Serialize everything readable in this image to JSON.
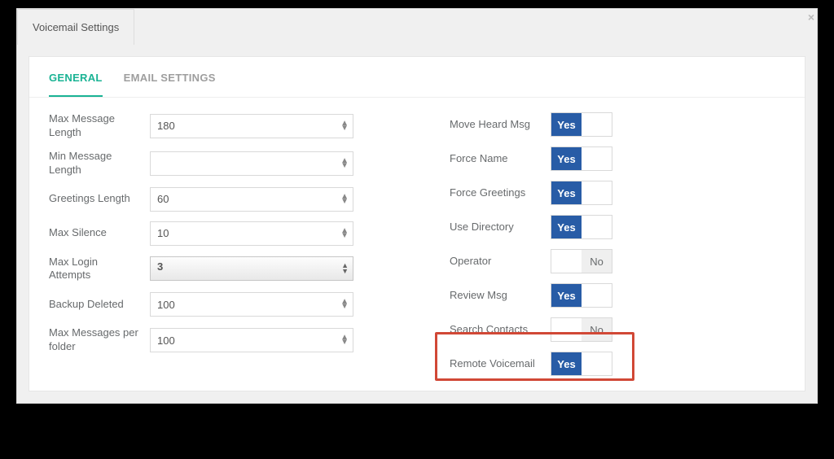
{
  "window_title": "Voicemail Settings",
  "close_glyph": "×",
  "tabs": {
    "general": "GENERAL",
    "email": "EMAIL SETTINGS"
  },
  "left": {
    "max_msg_len": {
      "label": "Max Message Length",
      "value": "180"
    },
    "min_msg_len": {
      "label": "Min Message Length",
      "value": ""
    },
    "greet_len": {
      "label": "Greetings Length",
      "value": "60"
    },
    "max_silence": {
      "label": "Max Silence",
      "value": "10"
    },
    "max_login": {
      "label": "Max Login Attempts",
      "value": "3"
    },
    "backup_del": {
      "label": "Backup Deleted",
      "value": "100"
    },
    "max_per_folder": {
      "label": "Max Messages per folder",
      "value": "100"
    }
  },
  "right": {
    "move_heard": {
      "label": "Move Heard Msg",
      "value": "Yes"
    },
    "force_name": {
      "label": "Force Name",
      "value": "Yes"
    },
    "force_greet": {
      "label": "Force Greetings",
      "value": "Yes"
    },
    "use_dir": {
      "label": "Use Directory",
      "value": "Yes"
    },
    "operator": {
      "label": "Operator",
      "value": "No"
    },
    "review_msg": {
      "label": "Review Msg",
      "value": "Yes"
    },
    "search_contacts": {
      "label": "Search Contacts",
      "value": "No"
    },
    "remote_vm": {
      "label": "Remote Voicemail",
      "value": "Yes"
    }
  },
  "yes_text": "Yes",
  "no_text": "No"
}
